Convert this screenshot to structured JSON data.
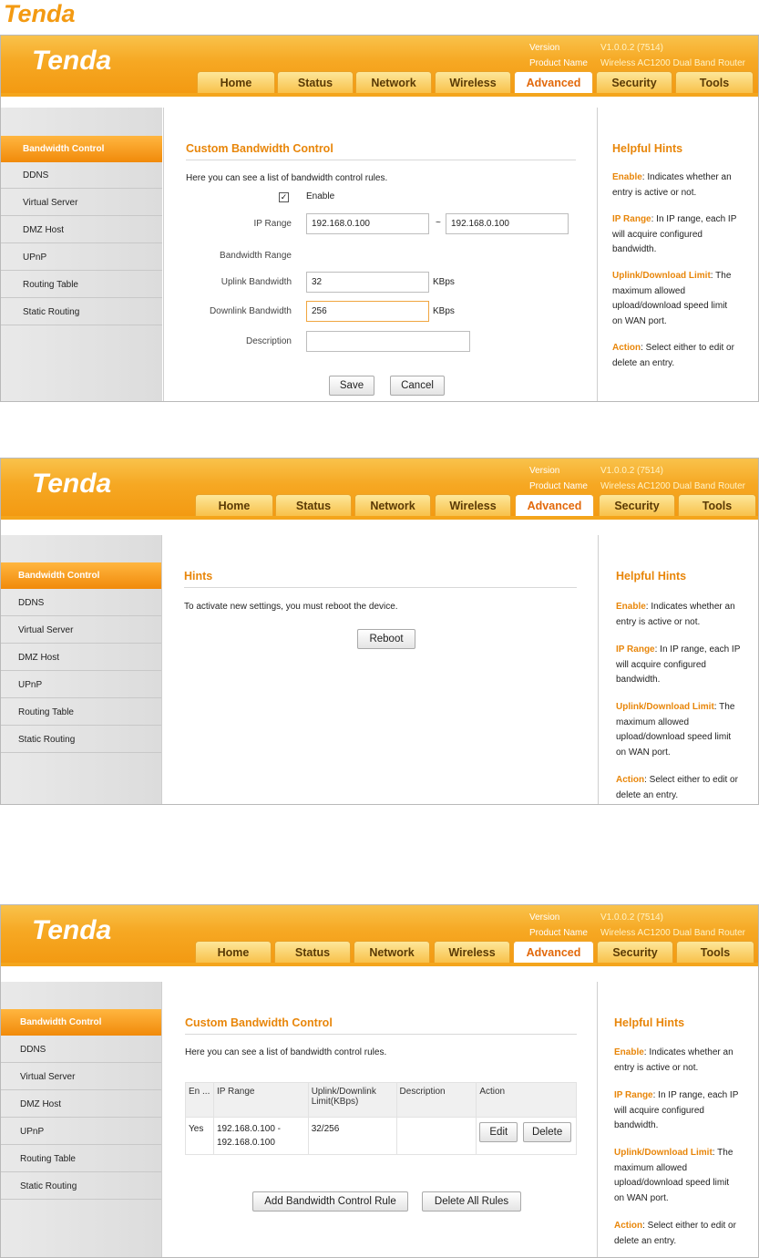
{
  "brand": {
    "name": "Tenda"
  },
  "version_label": "Version",
  "version_value": "V1.0.0.2 (7514)",
  "product_label": "Product Name",
  "product_value": "Wireless AC1200 Dual Band Router",
  "tabs": [
    "Home",
    "Status",
    "Network",
    "Wireless",
    "Advanced",
    "Security",
    "Tools"
  ],
  "active_tab": "Advanced",
  "sidebar": [
    "Bandwidth Control",
    "DDNS",
    "Virtual Server",
    "DMZ Host",
    "UPnP",
    "Routing Table",
    "Static Routing"
  ],
  "hints": {
    "title": "Helpful Hints",
    "enable_key": "Enable",
    "enable_text": ": Indicates whether an entry is active or not.",
    "iprange_key": "IP Range",
    "iprange_text": ": In IP range, each IP will acquire configured bandwidth.",
    "limit_key": "Uplink/Download Limit",
    "limit_text": ": The maximum allowed upload/download speed limit on WAN port.",
    "action_key": "Action",
    "action_text": ": Select either to edit or delete an entry."
  },
  "form": {
    "title": "Custom Bandwidth Control",
    "intro": "Here you can see a list of bandwidth control rules.",
    "enable_label": "Enable",
    "enable_checked": "✓",
    "ip_range_label": "IP Range",
    "ip_start": "192.168.0.100",
    "ip_sep": "~",
    "ip_end": "192.168.0.100",
    "bw_range_label": "Bandwidth Range",
    "uplink_label": "Uplink Bandwidth",
    "uplink_value": "32",
    "downlink_label": "Downlink Bandwidth",
    "downlink_value": "256",
    "unit": "KBps",
    "description_label": "Description",
    "description_value": "",
    "save": "Save",
    "cancel": "Cancel"
  },
  "reboot": {
    "title": "Hints",
    "message": "To activate new settings, you must reboot the device.",
    "button": "Reboot"
  },
  "list": {
    "title": "Custom Bandwidth Control",
    "intro": "Here you can see a list of bandwidth control rules.",
    "columns": [
      "En ...",
      "IP Range",
      "Uplink/Downlink Limit(KBps)",
      "Description",
      "Action"
    ],
    "rows": [
      {
        "enable": "Yes",
        "ip_range": "192.168.0.100 - 192.168.0.100",
        "limit": "32/256",
        "description": "",
        "edit": "Edit",
        "delete": "Delete"
      }
    ],
    "add_button": "Add Bandwidth Control Rule",
    "delete_all_button": "Delete All Rules"
  }
}
